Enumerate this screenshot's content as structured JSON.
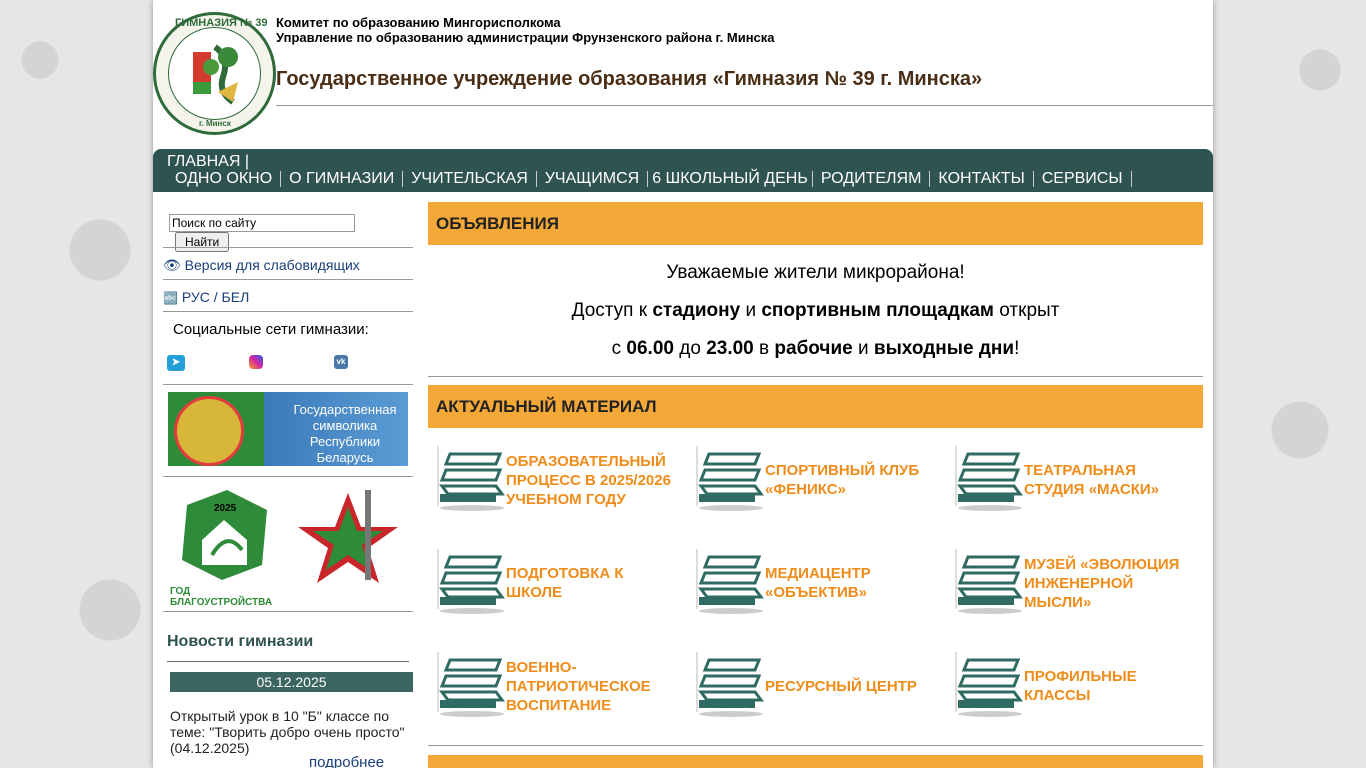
{
  "header": {
    "line1": "Комитет по образованию Мингорисполкома",
    "line2": "Управление по образованию администрации Фрунзенского района г. Минска",
    "title": "Государственное учреждение образования «Гимназия № 39 г. Минска»",
    "logo_text_top": "ГИМНАЗИЯ № 39",
    "logo_text_bottom": "г. Минск"
  },
  "nav": {
    "home": "ГЛАВНАЯ |",
    "items": [
      "ОДНО ОКНО",
      "О ГИМНАЗИИ",
      "УЧИТЕЛЬСКАЯ",
      "УЧАЩИМСЯ",
      "6 ШКОЛЬНЫЙ ДЕНЬ",
      "РОДИТЕЛЯМ",
      "КОНТАКТЫ",
      "СЕРВИСЫ"
    ]
  },
  "sidebar": {
    "search_placeholder": "Поиск по сайту",
    "search_button": "Найти",
    "low_vision": "Версия для слабовидящих",
    "lang": "РУС / БЕЛ",
    "social_label": "Социальные сети гимназии:",
    "banner_text": "Государственная символика Республики Беларусь",
    "year_label": "ГОД БЛАГОУСТРОЙСТВА",
    "year_number": "2025",
    "news_title": "Новости гимназии",
    "news_date": "05.12.2025",
    "news_text": "Открытый урок в 10 \"Б\" классе по теме: \"Творить добро очень просто\" (04.12.2025)",
    "news_more": "подробнее"
  },
  "main": {
    "announcements_title": "ОБЪЯВЛЕНИЯ",
    "ann_line1": "Уважаемые жители микрорайона!",
    "ann_line2": {
      "a": "Доступ к ",
      "b": "стадиону",
      "c": " и ",
      "d": "спортивным площадкам",
      "e": " открыт"
    },
    "ann_line3": {
      "a": "с ",
      "b": "06.00",
      "c": " до ",
      "d": "23.00",
      "e": " в ",
      "f": "рабочие",
      "g": " и ",
      "h": "выходные дни",
      "i": "!"
    },
    "actual_title": "АКТУАЛЬНЫЙ МАТЕРИАЛ",
    "tiles": [
      "Образовательный процесс в 2025/2026 учебном году",
      "Спортивный клуб «Феникс»",
      "Театральная студия «Маски»",
      "Подготовка к школе",
      "Медиацентр «Объектив»",
      "Музей «Эволюция инженерной мысли»",
      "Военно-патриотическое воспитание",
      "Ресурсный центр",
      "Профильные классы"
    ]
  },
  "colors": {
    "nav_bg": "#2f5350",
    "section_head": "#f4a838",
    "tile_text": "#f08c1a",
    "books": "#2f6a63"
  }
}
